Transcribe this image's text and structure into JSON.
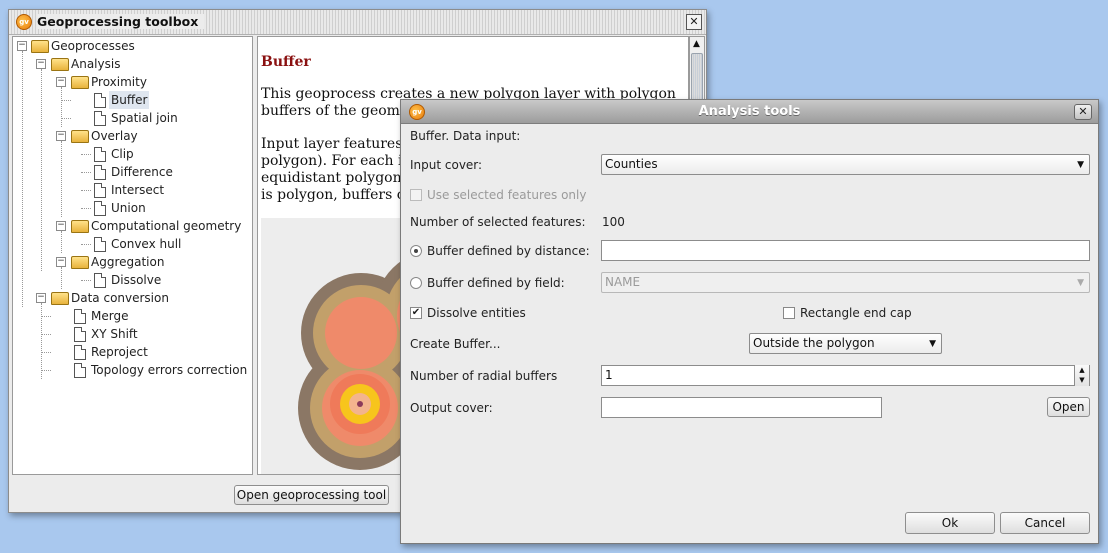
{
  "toolbox": {
    "title": "Geoprocessing toolbox",
    "close_symbol": "✕",
    "tree": {
      "root": "Geoprocesses",
      "analysis": "Analysis",
      "proximity": "Proximity",
      "buffer": "Buffer",
      "spatial_join": "Spatial join",
      "overlay": "Overlay",
      "clip": "Clip",
      "difference": "Difference",
      "intersect": "Intersect",
      "union": "Union",
      "computational_geometry": "Computational geometry",
      "convex_hull": "Convex hull",
      "aggregation": "Aggregation",
      "dissolve": "Dissolve",
      "data_conversion": "Data conversion",
      "merge": "Merge",
      "xy_shift": "XY Shift",
      "reproject": "Reproject",
      "topology": "Topology errors correction",
      "selected": "Buffer"
    },
    "help": {
      "title": "Buffer",
      "p1_line1": "This geoprocess creates a new polygon layer with polygon",
      "p1_line2": "buffers of the geome",
      "p2_line1": "Input layer features c",
      "p2_line2": "polygon). For each in",
      "p2_line3": "equidistant polygon w",
      "p2_line4": "is polygon, buffers ca",
      "ring_colors": [
        "#8b7765",
        "#c2a06a",
        "#ef8a6a",
        "#f2b57a",
        "#ef7a5a",
        "#f7c51c",
        "#f3b48e",
        "#8b3a5a"
      ]
    },
    "open_button": "Open geoprocessing tool"
  },
  "dialog": {
    "title": "Analysis tools",
    "close_symbol": "✕",
    "section_label": "Buffer. Data input:",
    "input_cover_label": "Input cover:",
    "input_cover_value": "Counties",
    "use_selected_label": "Use selected features only",
    "use_selected_checked": false,
    "num_selected_label": "Number of selected features:",
    "num_selected_value": "100",
    "buffer_distance_label": "Buffer defined by distance:",
    "buffer_distance_value": "",
    "buffer_distance_selected": true,
    "buffer_field_label": "Buffer defined by field:",
    "buffer_field_value": "NAME",
    "dissolve_label": "Dissolve entities",
    "dissolve_checked": true,
    "rect_endcap_label": "Rectangle end cap",
    "rect_endcap_checked": false,
    "create_buffer_label": "Create Buffer...",
    "create_buffer_value": "Outside the polygon",
    "radial_label": "Number of radial buffers",
    "radial_value": "1",
    "output_cover_label": "Output cover:",
    "output_cover_value": "",
    "open_button": "Open",
    "ok_button": "Ok",
    "cancel_button": "Cancel"
  }
}
